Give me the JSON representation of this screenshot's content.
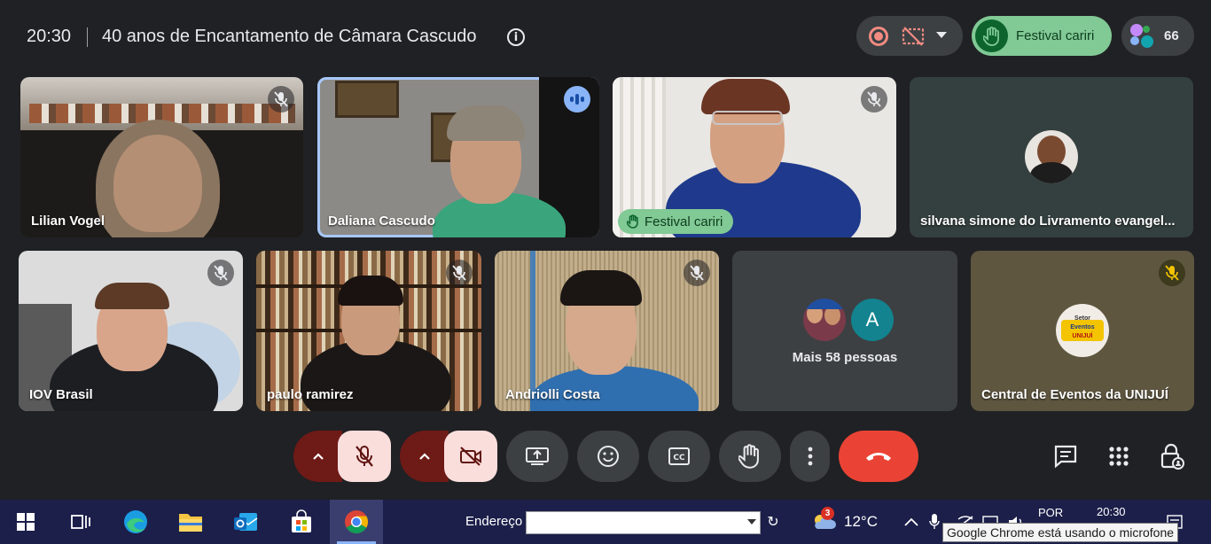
{
  "header": {
    "time": "20:30",
    "meeting_title": "40 anos de Encantamento de Câmara Cascudo",
    "info_icon": "info-icon",
    "raised_hand_label": "Festival cariri",
    "participant_count": "66"
  },
  "tiles": [
    {
      "name": "Lilian Vogel",
      "muted": true
    },
    {
      "name": "Daliana Cascudo",
      "speaking": true
    },
    {
      "name": "Festival cariri",
      "muted": true,
      "hand_raised": true
    },
    {
      "name": "silvana simone do Livramento evangel..."
    },
    {
      "name": "IOV Brasil",
      "muted": true
    },
    {
      "name": "paulo ramirez",
      "muted": true
    },
    {
      "name": "Andriolli Costa",
      "muted": true
    },
    {
      "name": "Mais 58 pessoas",
      "avatar_letter": "A"
    },
    {
      "name": "Central de Eventos da UNIJUÍ",
      "muted": true
    }
  ],
  "logo_text": {
    "line1": "Setor",
    "line2": "Eventos",
    "line3": "UNIJUÍ"
  },
  "controls": {
    "mic_state": "muted",
    "camera_state": "off",
    "end_call_color": "#ea4335"
  },
  "taskbar": {
    "address_label": "Endereço",
    "address_value": "",
    "weather_badge": "3",
    "temperature": "12°C",
    "language": "POR",
    "time": "20:30",
    "tooltip": "Google Chrome está usando o microfone"
  },
  "colors": {
    "accent_green": "#81c995",
    "speaking_blue": "#8ab4f8",
    "background": "#202124"
  }
}
